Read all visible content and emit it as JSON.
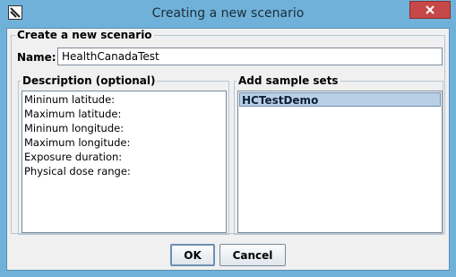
{
  "window": {
    "title": "Creating a new scenario"
  },
  "icons": {
    "app": "app-icon",
    "close": "close-icon"
  },
  "form": {
    "group_title": "Create a new scenario",
    "name_label": "Name:",
    "name_value": "HealthCanadaTest"
  },
  "description": {
    "title": "Description (optional)",
    "lines": [
      "Mininum latitude:",
      "Maximum latitude:",
      "Mininum longitude:",
      "Maximum longitude:",
      "Exposure duration:",
      "Physical dose range:"
    ]
  },
  "samples": {
    "title": "Add sample sets",
    "items": [
      "HCTestDemo"
    ]
  },
  "buttons": {
    "ok": "OK",
    "cancel": "Cancel"
  },
  "colors": {
    "window_frame": "#6fb1d9",
    "close_button": "#c74848",
    "selection": "#b8cfe5"
  }
}
